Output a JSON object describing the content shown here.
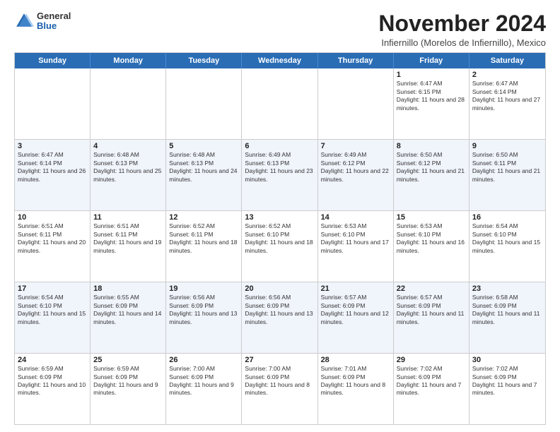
{
  "header": {
    "logo": {
      "general": "General",
      "blue": "Blue"
    },
    "month": "November 2024",
    "subtitle": "Infiernillo (Morelos de Infiernillo), Mexico"
  },
  "weekdays": [
    "Sunday",
    "Monday",
    "Tuesday",
    "Wednesday",
    "Thursday",
    "Friday",
    "Saturday"
  ],
  "rows": [
    {
      "alt": false,
      "cells": [
        {
          "day": "",
          "info": ""
        },
        {
          "day": "",
          "info": ""
        },
        {
          "day": "",
          "info": ""
        },
        {
          "day": "",
          "info": ""
        },
        {
          "day": "",
          "info": ""
        },
        {
          "day": "1",
          "info": "Sunrise: 6:47 AM\nSunset: 6:15 PM\nDaylight: 11 hours and 28 minutes."
        },
        {
          "day": "2",
          "info": "Sunrise: 6:47 AM\nSunset: 6:14 PM\nDaylight: 11 hours and 27 minutes."
        }
      ]
    },
    {
      "alt": true,
      "cells": [
        {
          "day": "3",
          "info": "Sunrise: 6:47 AM\nSunset: 6:14 PM\nDaylight: 11 hours and 26 minutes."
        },
        {
          "day": "4",
          "info": "Sunrise: 6:48 AM\nSunset: 6:13 PM\nDaylight: 11 hours and 25 minutes."
        },
        {
          "day": "5",
          "info": "Sunrise: 6:48 AM\nSunset: 6:13 PM\nDaylight: 11 hours and 24 minutes."
        },
        {
          "day": "6",
          "info": "Sunrise: 6:49 AM\nSunset: 6:13 PM\nDaylight: 11 hours and 23 minutes."
        },
        {
          "day": "7",
          "info": "Sunrise: 6:49 AM\nSunset: 6:12 PM\nDaylight: 11 hours and 22 minutes."
        },
        {
          "day": "8",
          "info": "Sunrise: 6:50 AM\nSunset: 6:12 PM\nDaylight: 11 hours and 21 minutes."
        },
        {
          "day": "9",
          "info": "Sunrise: 6:50 AM\nSunset: 6:11 PM\nDaylight: 11 hours and 21 minutes."
        }
      ]
    },
    {
      "alt": false,
      "cells": [
        {
          "day": "10",
          "info": "Sunrise: 6:51 AM\nSunset: 6:11 PM\nDaylight: 11 hours and 20 minutes."
        },
        {
          "day": "11",
          "info": "Sunrise: 6:51 AM\nSunset: 6:11 PM\nDaylight: 11 hours and 19 minutes."
        },
        {
          "day": "12",
          "info": "Sunrise: 6:52 AM\nSunset: 6:11 PM\nDaylight: 11 hours and 18 minutes."
        },
        {
          "day": "13",
          "info": "Sunrise: 6:52 AM\nSunset: 6:10 PM\nDaylight: 11 hours and 18 minutes."
        },
        {
          "day": "14",
          "info": "Sunrise: 6:53 AM\nSunset: 6:10 PM\nDaylight: 11 hours and 17 minutes."
        },
        {
          "day": "15",
          "info": "Sunrise: 6:53 AM\nSunset: 6:10 PM\nDaylight: 11 hours and 16 minutes."
        },
        {
          "day": "16",
          "info": "Sunrise: 6:54 AM\nSunset: 6:10 PM\nDaylight: 11 hours and 15 minutes."
        }
      ]
    },
    {
      "alt": true,
      "cells": [
        {
          "day": "17",
          "info": "Sunrise: 6:54 AM\nSunset: 6:10 PM\nDaylight: 11 hours and 15 minutes."
        },
        {
          "day": "18",
          "info": "Sunrise: 6:55 AM\nSunset: 6:09 PM\nDaylight: 11 hours and 14 minutes."
        },
        {
          "day": "19",
          "info": "Sunrise: 6:56 AM\nSunset: 6:09 PM\nDaylight: 11 hours and 13 minutes."
        },
        {
          "day": "20",
          "info": "Sunrise: 6:56 AM\nSunset: 6:09 PM\nDaylight: 11 hours and 13 minutes."
        },
        {
          "day": "21",
          "info": "Sunrise: 6:57 AM\nSunset: 6:09 PM\nDaylight: 11 hours and 12 minutes."
        },
        {
          "day": "22",
          "info": "Sunrise: 6:57 AM\nSunset: 6:09 PM\nDaylight: 11 hours and 11 minutes."
        },
        {
          "day": "23",
          "info": "Sunrise: 6:58 AM\nSunset: 6:09 PM\nDaylight: 11 hours and 11 minutes."
        }
      ]
    },
    {
      "alt": false,
      "cells": [
        {
          "day": "24",
          "info": "Sunrise: 6:59 AM\nSunset: 6:09 PM\nDaylight: 11 hours and 10 minutes."
        },
        {
          "day": "25",
          "info": "Sunrise: 6:59 AM\nSunset: 6:09 PM\nDaylight: 11 hours and 9 minutes."
        },
        {
          "day": "26",
          "info": "Sunrise: 7:00 AM\nSunset: 6:09 PM\nDaylight: 11 hours and 9 minutes."
        },
        {
          "day": "27",
          "info": "Sunrise: 7:00 AM\nSunset: 6:09 PM\nDaylight: 11 hours and 8 minutes."
        },
        {
          "day": "28",
          "info": "Sunrise: 7:01 AM\nSunset: 6:09 PM\nDaylight: 11 hours and 8 minutes."
        },
        {
          "day": "29",
          "info": "Sunrise: 7:02 AM\nSunset: 6:09 PM\nDaylight: 11 hours and 7 minutes."
        },
        {
          "day": "30",
          "info": "Sunrise: 7:02 AM\nSunset: 6:09 PM\nDaylight: 11 hours and 7 minutes."
        }
      ]
    }
  ]
}
